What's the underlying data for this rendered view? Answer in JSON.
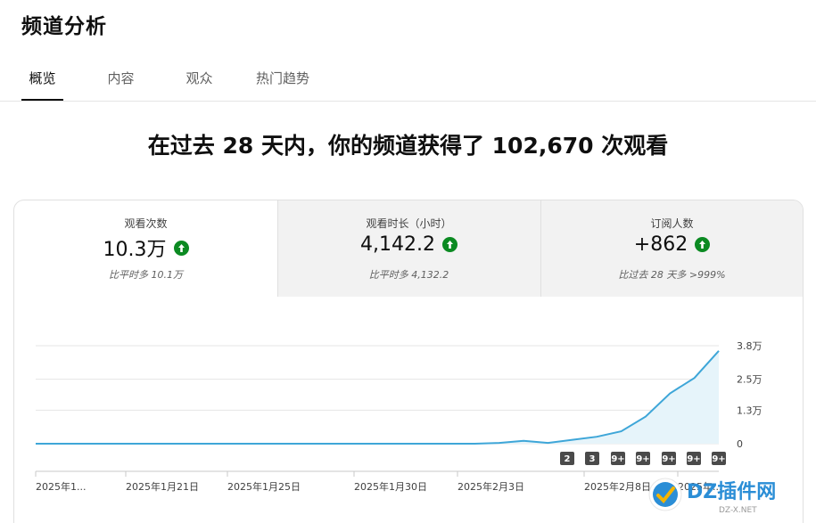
{
  "page_title": "频道分析",
  "tabs": [
    {
      "label": "概览",
      "active": true
    },
    {
      "label": "内容",
      "active": false
    },
    {
      "label": "观众",
      "active": false
    },
    {
      "label": "热门趋势",
      "active": false
    }
  ],
  "headline": "在过去 28 天内，你的频道获得了 102,670 次观看",
  "metrics": [
    {
      "label": "观看次数",
      "value": "10.3万",
      "sub": "比平时多 10.1万",
      "selected": true
    },
    {
      "label": "观看时长（小时）",
      "value": "4,142.2",
      "sub": "比平时多 4,132.2",
      "selected": false
    },
    {
      "label": "订阅人数",
      "value": "+862",
      "sub": "比过去 28 天多 >999%",
      "selected": false
    }
  ],
  "colors": {
    "accent": "#3ea6d8",
    "fill": "#e6f4fa",
    "up": "#0b8a22",
    "badge": "#4a4a4a"
  },
  "chart_data": {
    "type": "area",
    "y_tick_labels": [
      "3.8万",
      "2.5万",
      "1.3万",
      "0"
    ],
    "ylim": [
      0,
      38000
    ],
    "x_tick_labels": [
      "2025年1...",
      "2025年1月21日",
      "2025年1月25日",
      "2025年1月30日",
      "2025年2月3日",
      "2025年2月8日",
      "2025年..."
    ],
    "x": [
      "d1",
      "d2",
      "d3",
      "d4",
      "d5",
      "d6",
      "d7",
      "d8",
      "d9",
      "d10",
      "d11",
      "d12",
      "d13",
      "d14",
      "d15",
      "d16",
      "d17",
      "d18",
      "d19",
      "d20",
      "d21",
      "d22",
      "d23",
      "d24",
      "d25",
      "d26",
      "d27",
      "d28"
    ],
    "values": [
      0,
      0,
      0,
      0,
      0,
      0,
      0,
      0,
      0,
      0,
      0,
      0,
      0,
      0,
      0,
      0,
      0,
      0,
      0,
      300,
      1100,
      300,
      1500,
      2700,
      4800,
      10500,
      19500,
      25500,
      36000
    ],
    "badges": [
      "2",
      "3",
      "9+",
      "9+",
      "9+",
      "9+",
      "9+"
    ],
    "grid": true
  },
  "watermark": {
    "text": "DZ插件网",
    "sub": "DZ-X.NET"
  }
}
